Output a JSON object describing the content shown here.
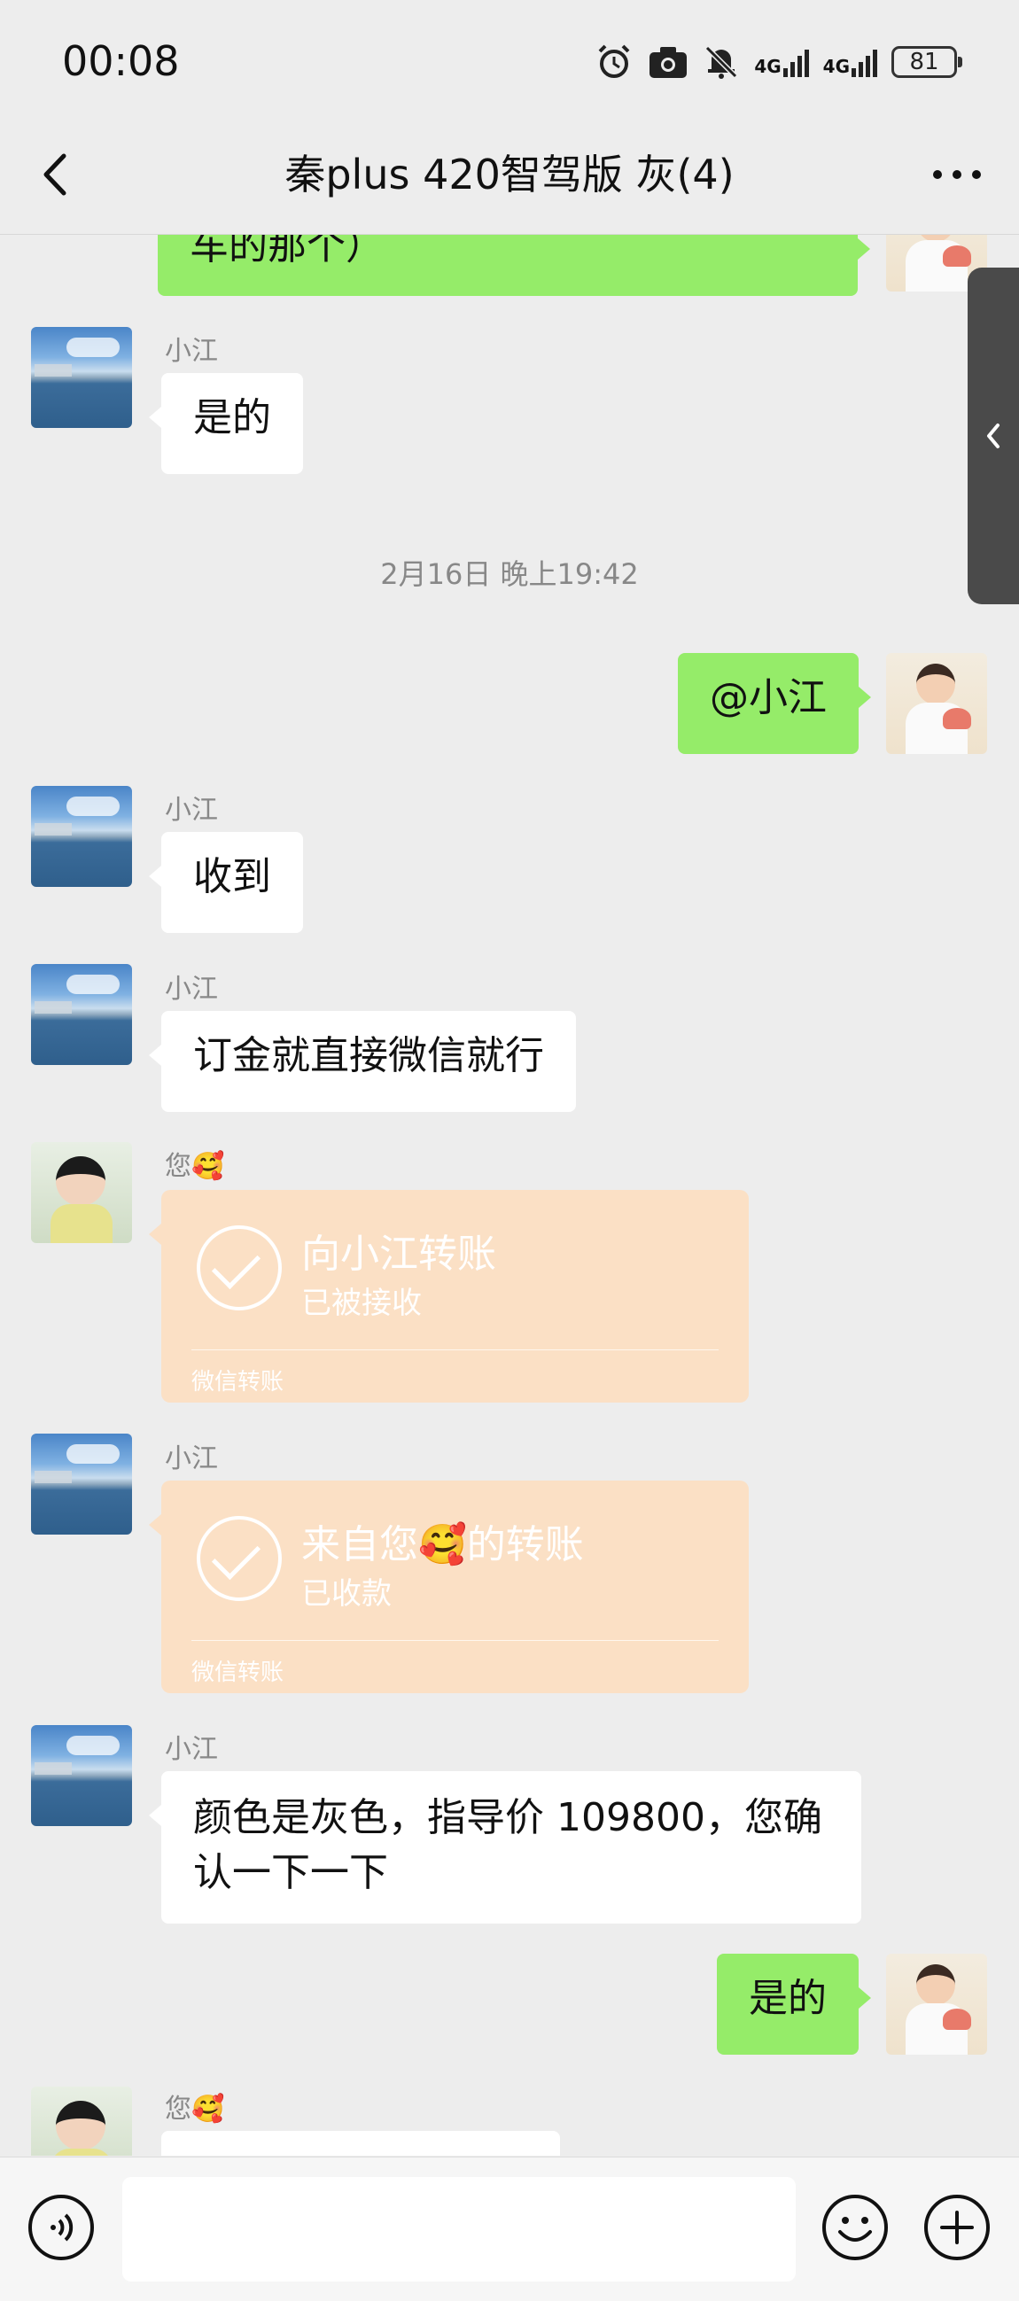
{
  "status_bar": {
    "time": "00:08",
    "network_1": "4G",
    "network_2": "4G",
    "battery": "81",
    "icons": [
      "alarm-icon",
      "camera-icon",
      "mute-icon",
      "signal-icon",
      "signal-icon",
      "battery-icon"
    ]
  },
  "header": {
    "back_icon": "chevron-left-icon",
    "title": "秦plus 420智驾版 灰(4)",
    "more_icon": "ellipsis-icon"
  },
  "messages": [
    {
      "type": "text",
      "side": "right",
      "text": "车的那个）"
    },
    {
      "type": "text",
      "side": "left",
      "sender": "小江",
      "text": "是的"
    },
    {
      "type": "timestamp",
      "text": "2月16日 晚上19:42"
    },
    {
      "type": "text",
      "side": "right",
      "text": "@小江"
    },
    {
      "type": "text",
      "side": "left",
      "sender": "小江",
      "text": "收到"
    },
    {
      "type": "text",
      "side": "left",
      "sender": "小江",
      "text": "订金就直接微信就行"
    },
    {
      "type": "transfer",
      "side": "left",
      "sender": "您🥰",
      "title": "向小江转账",
      "status": "已被接收",
      "footer": "微信转账"
    },
    {
      "type": "transfer",
      "side": "left",
      "sender": "小江",
      "title": "来自您🥰的转账",
      "status": "已收款",
      "footer": "微信转账"
    },
    {
      "type": "text",
      "side": "left",
      "sender": "小江",
      "text": "颜色是灰色，指导价 109800，您确认一下一下"
    },
    {
      "type": "text",
      "side": "right",
      "text": "是的"
    },
    {
      "type": "partial",
      "side": "left",
      "sender": "您🥰"
    }
  ],
  "input_bar": {
    "voice_icon": "voice-icon",
    "emoji_icon": "emoji-icon",
    "plus_icon": "plus-icon",
    "text": ""
  },
  "colors": {
    "background": "#ededed",
    "bubble_self": "#95ec69",
    "bubble_other": "#ffffff",
    "transfer_card": "#fbe0c5"
  }
}
